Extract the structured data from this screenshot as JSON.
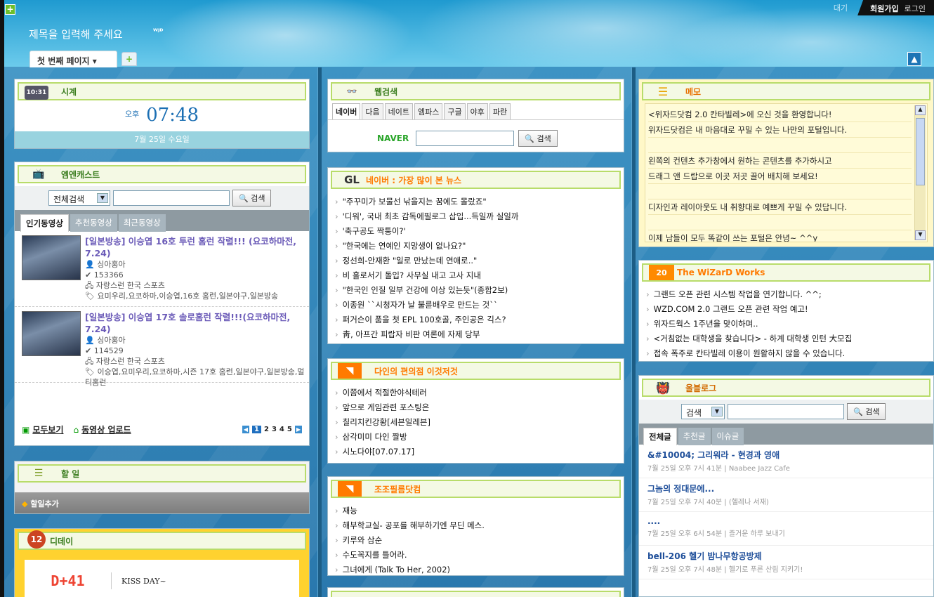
{
  "header": {
    "title": "제목을 입력해 주세요",
    "logo_text": "ᵂᴶᴰ",
    "top_links": {
      "waiting": "대기",
      "join": "회원가입",
      "login": "로그인"
    },
    "tab_label": "첫 번째 페이지 ▾"
  },
  "clock": {
    "title": "시계",
    "ampm": "오후",
    "time": "07:48",
    "date": "7월 25일 수요일"
  },
  "ucc": {
    "title": "엠엔캐스트",
    "select": "전체검색",
    "search_btn": "검색",
    "tabs": [
      "인기동영상",
      "추천동영상",
      "최근동영상"
    ],
    "items": [
      {
        "title": "[일본방송] 이승엽 16호 투런 홈런 작렬!!! (요코하마전, 7.24)",
        "user": "싱아홍아",
        "views": "153366",
        "channel": "자랑스런 한국 스포츠",
        "tags": "요미우리,요코하마,이승엽,16호 홈런,일본야구,일본방송"
      },
      {
        "title": "[일본방송] 이승엽 17호 솔로홈런 작렬!!!(요코하마전, 7.24)",
        "user": "싱아홍아",
        "views": "114529",
        "channel": "자랑스런 한국 스포츠",
        "tags": "이승엽,요미우리,요코하마,시즌 17호 홈런,일본야구,일본방송,멀티홈런"
      }
    ],
    "all_label": "모두보기",
    "upload_label": "동영상 업로드",
    "pages": [
      "1",
      "2",
      "3",
      "4",
      "5"
    ]
  },
  "todo": {
    "title": "할 일",
    "add_label": "할일추가"
  },
  "dday": {
    "title": "디데이",
    "badge": "12",
    "count": "D+41",
    "label": "KISS DAY~"
  },
  "websearch": {
    "title": "웹검색",
    "tabs": [
      "네이버",
      "다음",
      "네이트",
      "엠파스",
      "구글",
      "야후",
      "파란"
    ],
    "engine": "NAVER",
    "button": "검색"
  },
  "news": {
    "title": "네이버 : 가장 많이 본 뉴스",
    "items": [
      "\"주꾸미가 보물선 낚을지는 꿈에도 몰랐죠\"",
      "'디워', 국내 최초 감독에필로그 삽입...득일까 실일까",
      "'축구공도 짝퉁이?'",
      "\"한국에는 연예인 지망생이 없나요?\"",
      "정선희-안재환 \"일로 만났는데 연애로..\"",
      "비 홀로서기 돌입? 사무실 내고 고사 지내",
      "\"한국인 인질 일부 건강에 이상 있는듯\"(종합2보)",
      "이종원 ``시청자가 날 불륜배우로 만드는 것``",
      "퍼거슨이 품을 첫 EPL 100호골, 주인공은 긱스?",
      "靑, 아프간 피랍자 비판 여론에 자제 당부"
    ]
  },
  "rss1": {
    "title": "다인의 편의점 이것저것",
    "items": [
      "이쯤에서 적절한야식테러",
      "앞으로 게임관련 포스팅은",
      "칠리치킨강황[세븐일레븐]",
      "삼각미미 다인 짤방",
      "시노다야[07.07.17]"
    ]
  },
  "rss2": {
    "title": "조조필름닷컴",
    "items": [
      "재능",
      "해부학교실- 공포를 해부하기엔 무딘 메스.",
      "키루와 삼순",
      "수도꼭지를 틀어라.",
      "그녀에게 (Talk To Her, 2002)"
    ]
  },
  "memo": {
    "title": "메모",
    "lines": [
      "<위자드닷컴 2.0 칸타빌레>에 오신 것을 환영합니다!",
      "위자드닷컴은 내 마음대로 꾸밀 수 있는 나만의 포털입니다.",
      "",
      "왼쪽의 컨텐츠 추가창에서 원하는 콘텐츠를 추가하시고",
      "드래그 앤 드랍으로 이곳 저곳 끌어 배치해 보세요!",
      "",
      "디자인과 레이아웃도 내 취향대로 예쁘게 꾸밀 수 있답니다.",
      "",
      "이제 남들이 모두 똑같이 쓰는 포털은 안녕~ ^^y"
    ]
  },
  "wizard": {
    "title": "The WiZarD Works",
    "items": [
      "그랜드 오픈 관련 시스템 작업을 연기합니다. ^^;",
      "WZD.COM 2.0 그랜드 오픈 관련 작업 예고!",
      "위자드웍스 1주년을 맞이하며..",
      "<거침없는 대학생을 찾습니다> - 하계 대학생 인턴 大모집",
      "접속 폭주로 칸타빌레 이용이 원활하지 않을 수 있습니다."
    ]
  },
  "allblog": {
    "title": "올블로그",
    "select": "검색",
    "button": "검색",
    "tabs": [
      "전체글",
      "추천글",
      "이슈글"
    ],
    "posts": [
      {
        "title": "&#10004; 그리워라 - 현경과 영애",
        "meta": "7월 25일 오후 7시 41분 | Naabee Jazz Cafe"
      },
      {
        "title": "그놈의 정대문에...",
        "meta": "7월 25일 오후 7시 40분 | (헬레나 서재)"
      },
      {
        "title": "....",
        "meta": "7월 25일 오후 6시 54분 | 즐거운 하루 보내기"
      },
      {
        "title": "bell-206 헬기 밤나무항공방제",
        "meta": "7월 25일 오후 7시 48분 | 헬기로 푸른 산림 지키기!"
      }
    ]
  }
}
